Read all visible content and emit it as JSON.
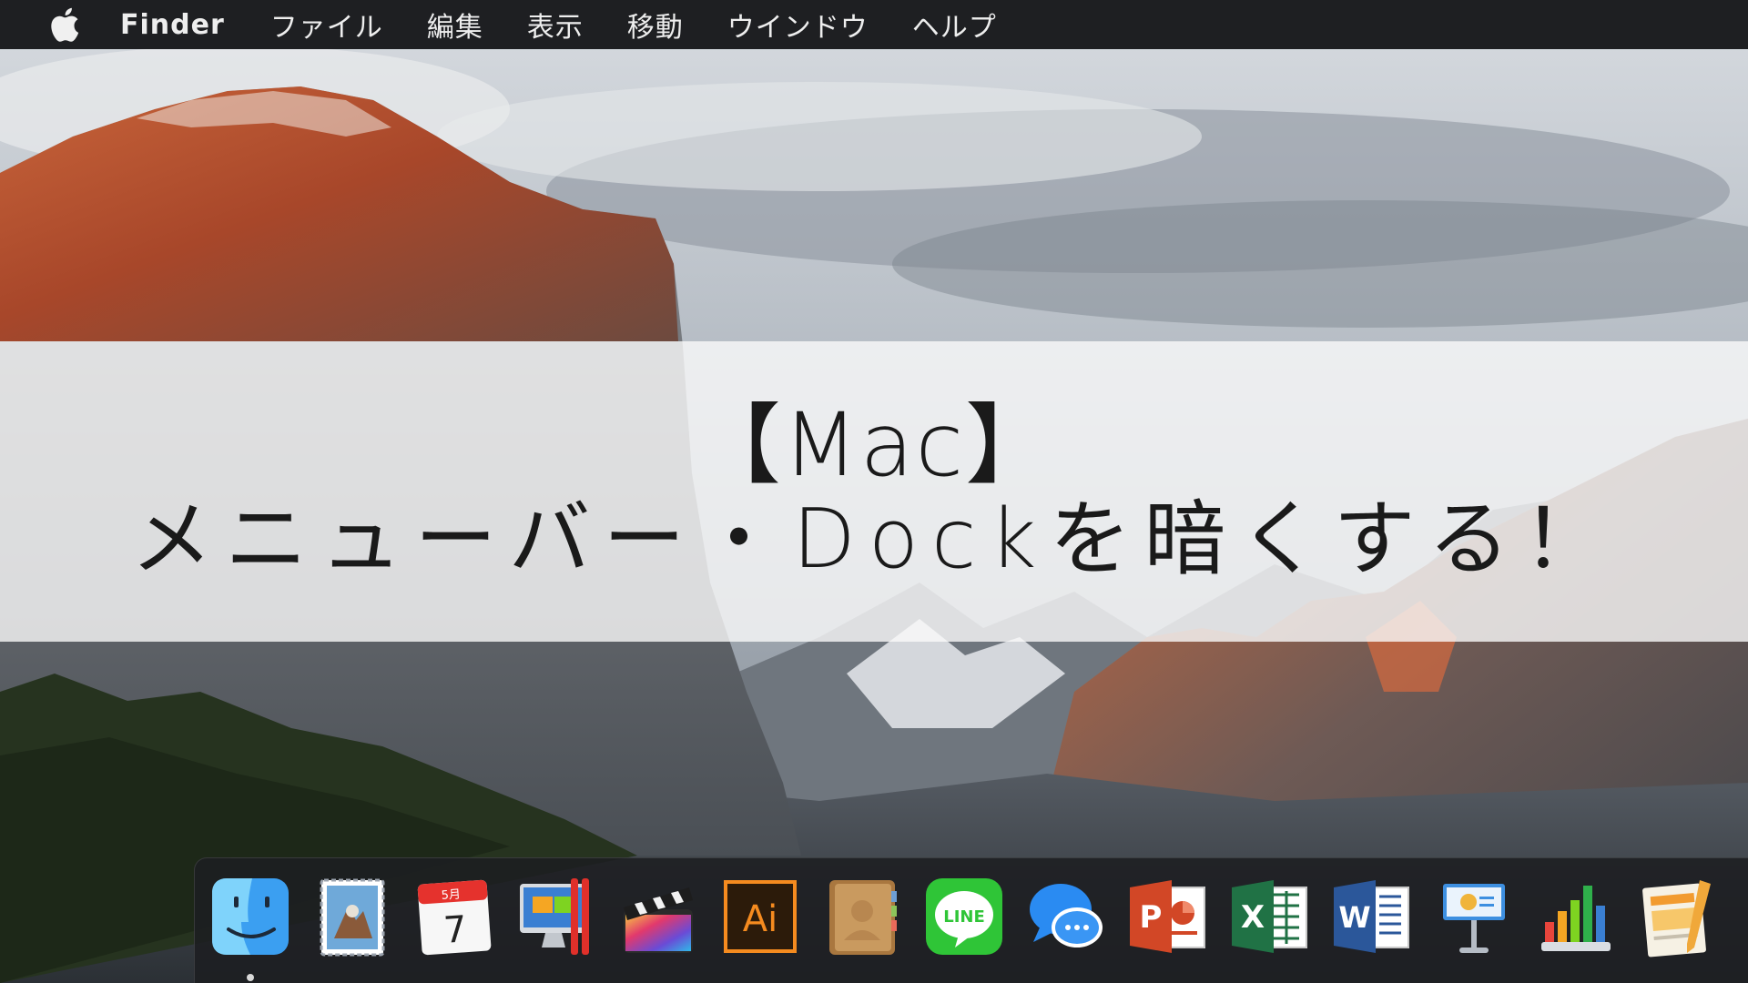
{
  "menubar": {
    "apple_icon": "apple-icon",
    "app_name": "Finder",
    "items": [
      "ファイル",
      "編集",
      "表示",
      "移動",
      "ウインドウ",
      "ヘルプ"
    ]
  },
  "title": {
    "line1": "【Mac】",
    "line2": "メニューバー・Dockを暗くする！"
  },
  "dock": {
    "apps": [
      {
        "name": "finder-icon",
        "running": true
      },
      {
        "name": "preview-icon",
        "running": false
      },
      {
        "name": "calendar-icon",
        "running": false,
        "month": "5月",
        "day": "7"
      },
      {
        "name": "parallels-desktop-icon",
        "running": false
      },
      {
        "name": "final-cut-pro-icon",
        "running": false
      },
      {
        "name": "illustrator-icon",
        "running": false,
        "label": "Ai"
      },
      {
        "name": "contacts-icon",
        "running": false
      },
      {
        "name": "line-icon",
        "running": false,
        "label": "LINE"
      },
      {
        "name": "messages-icon",
        "running": false
      },
      {
        "name": "powerpoint-icon",
        "running": false,
        "label": "P"
      },
      {
        "name": "excel-icon",
        "running": false,
        "label": "X"
      },
      {
        "name": "word-icon",
        "running": false,
        "label": "W"
      },
      {
        "name": "keynote-icon",
        "running": false
      },
      {
        "name": "numbers-icon",
        "running": false
      },
      {
        "name": "pages-icon",
        "running": false
      }
    ]
  },
  "colors": {
    "menubar_bg": "#1e1f22",
    "dock_bg": "#1c1e21",
    "title_band": "#fafafa"
  }
}
